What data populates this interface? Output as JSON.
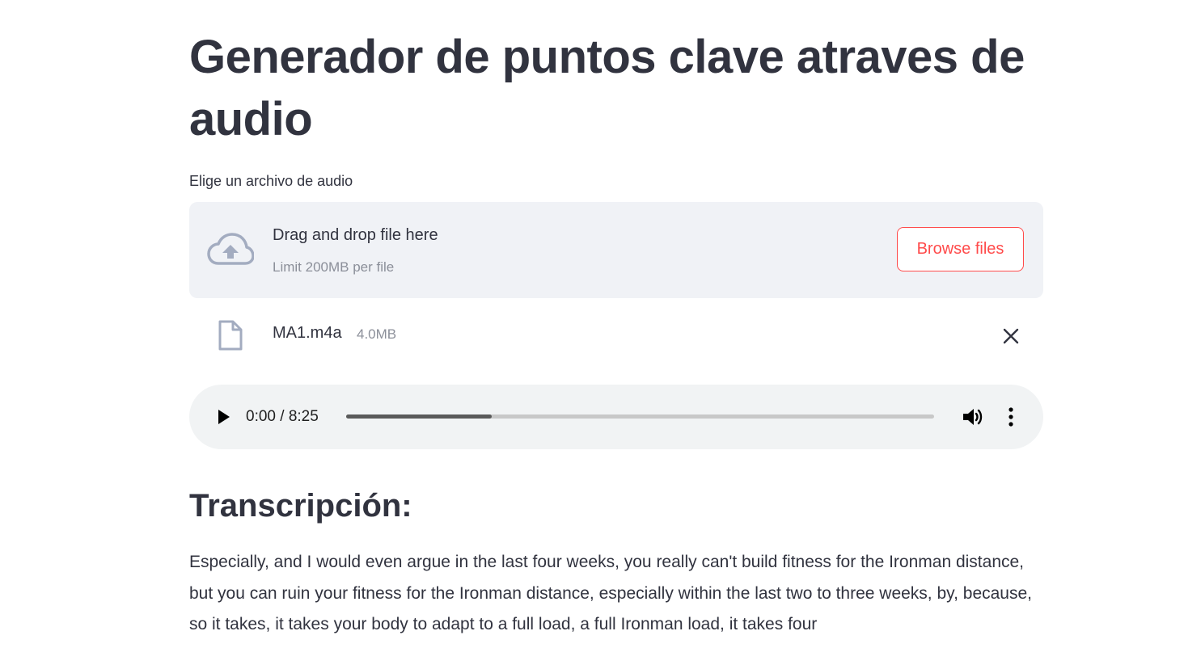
{
  "page": {
    "title": "Generador de puntos clave atraves de audio"
  },
  "uploader": {
    "label": "Elige un archivo de audio",
    "drop_text": "Drag and drop file here",
    "limit_text": "Limit 200MB per file",
    "browse_label": "Browse files",
    "icon": "cloud-upload-icon"
  },
  "file": {
    "name": "MA1.m4a",
    "size": "4.0MB",
    "icon": "file-icon"
  },
  "audio": {
    "time": "0:00 / 8:25",
    "progress_fraction": 0.247
  },
  "transcription": {
    "heading": "Transcripción:",
    "text": "Especially, and I would even argue in the last four weeks, you really can't build fitness for the Ironman distance, but you can ruin your fitness for the Ironman distance, especially within the last two to three weeks, by, because, so it takes, it takes your body to adapt to a full load, a full Ironman load, it takes four"
  },
  "colors": {
    "text": "#31333f",
    "accent": "#ff4b4b",
    "dropzone_bg": "#f0f2f6",
    "muted": "#8b8f99"
  }
}
